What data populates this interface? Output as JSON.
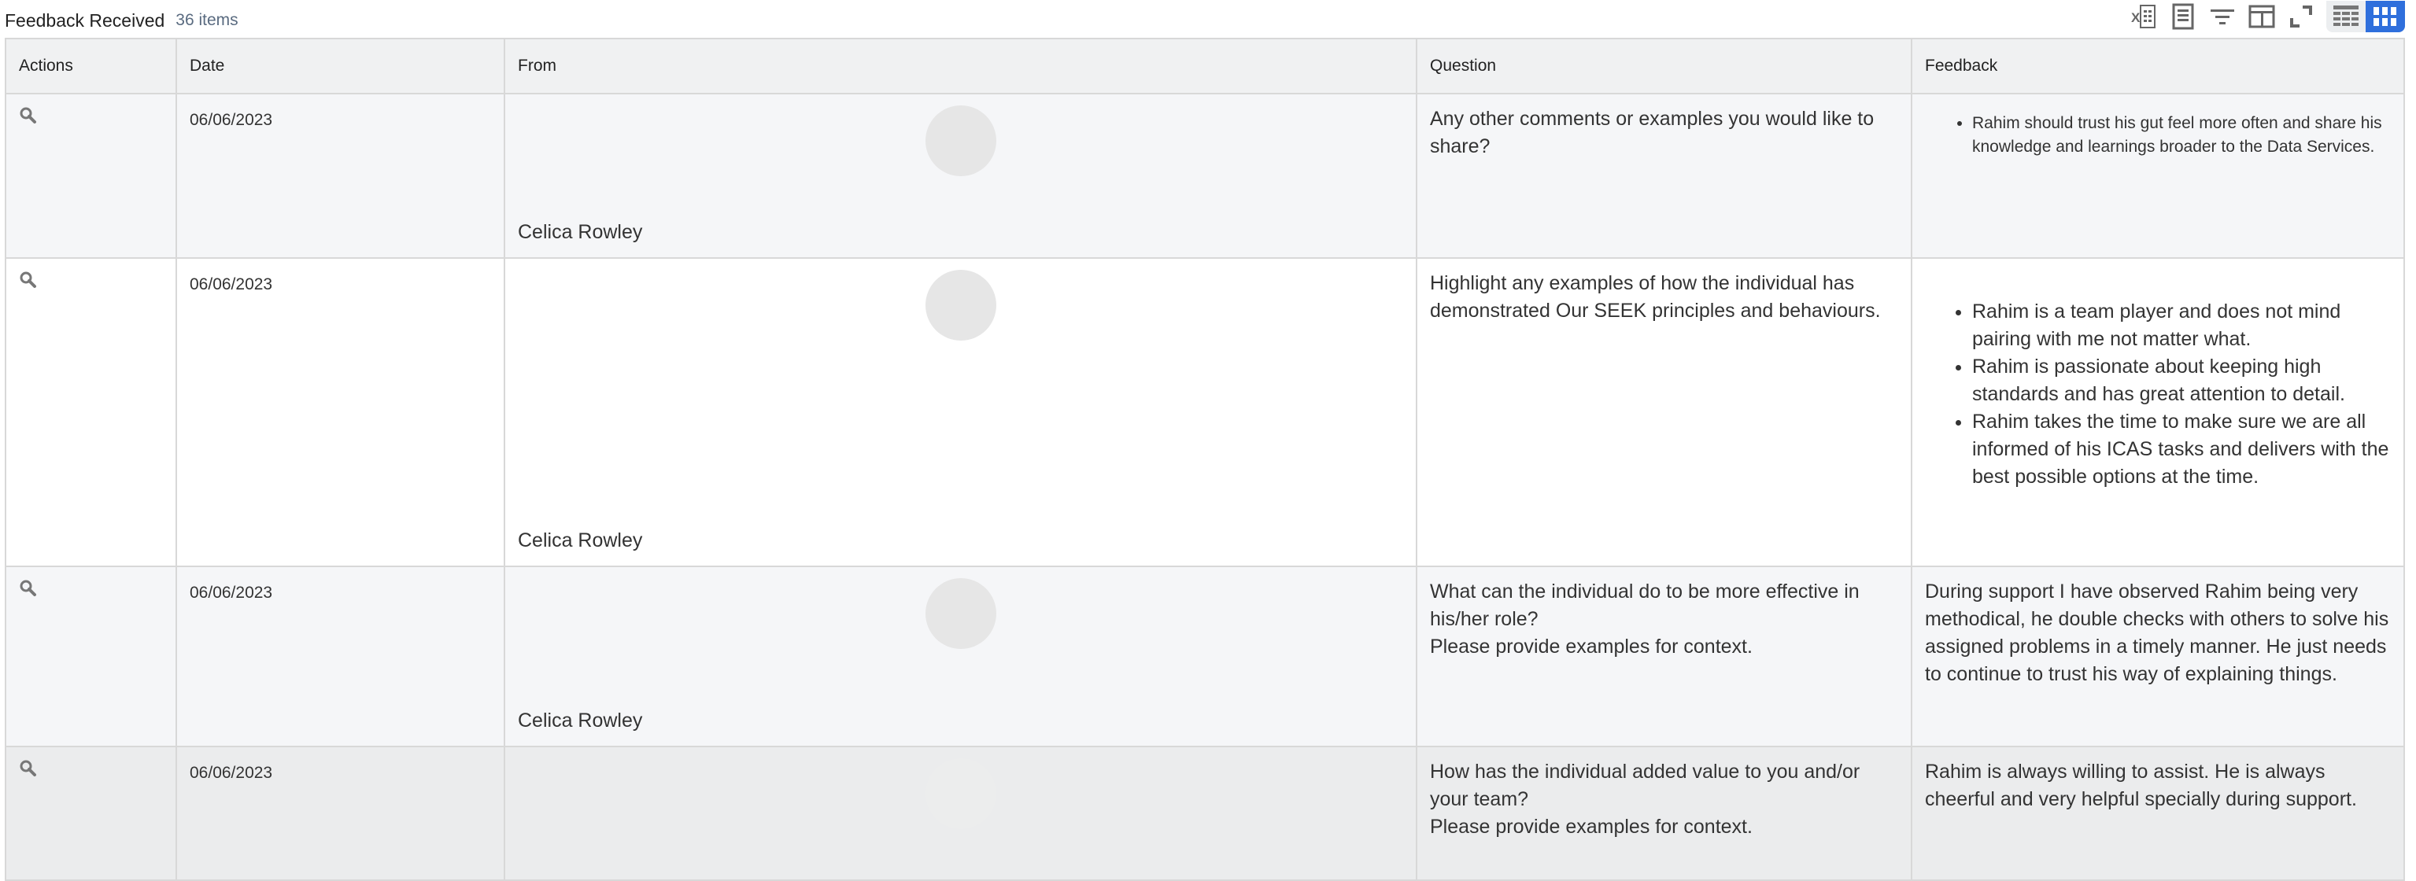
{
  "header": {
    "title": "Feedback Received",
    "count": "36 items"
  },
  "toolbar": {
    "icons": [
      "export-excel-icon",
      "print-icon",
      "filter-icon",
      "column-layout-icon",
      "fullscreen-icon"
    ],
    "view_toggle": [
      "table-view-icon",
      "grid-view-icon"
    ],
    "accent": "#2f6fdc"
  },
  "table": {
    "columns": [
      "Actions",
      "Date",
      "From",
      "Question",
      "Feedback"
    ],
    "rows": [
      {
        "date": "06/06/2023",
        "from": "Celica Rowley",
        "question": [
          "Any other comments or examples you would like to share?"
        ],
        "feedback_list": [
          "Rahim should trust his gut feel more often and share his knowledge and learnings broader to the Data Services."
        ]
      },
      {
        "date": "06/06/2023",
        "from": "Celica Rowley",
        "question": [
          "Highlight any examples of how the individual has demonstrated Our SEEK principles and behaviours."
        ],
        "feedback_list": [
          "Rahim is a team player and does not mind pairing with me not matter what.",
          "Rahim is passionate about keeping high standards and has great attention to detail.",
          "Rahim takes the time to make sure we are all informed of his ICAS tasks and delivers with the best possible options at the time."
        ]
      },
      {
        "date": "06/06/2023",
        "from": "Celica Rowley",
        "question": [
          "What can the individual do to be more effective in his/her role?",
          "Please provide examples for context."
        ],
        "feedback_text": "During support I have observed Rahim being very methodical, he double checks with others to solve his assigned problems in a timely manner. He just needs to continue to trust his way of explaining things."
      },
      {
        "date": "06/06/2023",
        "from": "",
        "question": [
          "How has the individual added value to you and/or your team?",
          "Please provide examples for context."
        ],
        "feedback_text": "Rahim is always willing to assist. He is always cheerful and very helpful specially during support."
      }
    ]
  }
}
